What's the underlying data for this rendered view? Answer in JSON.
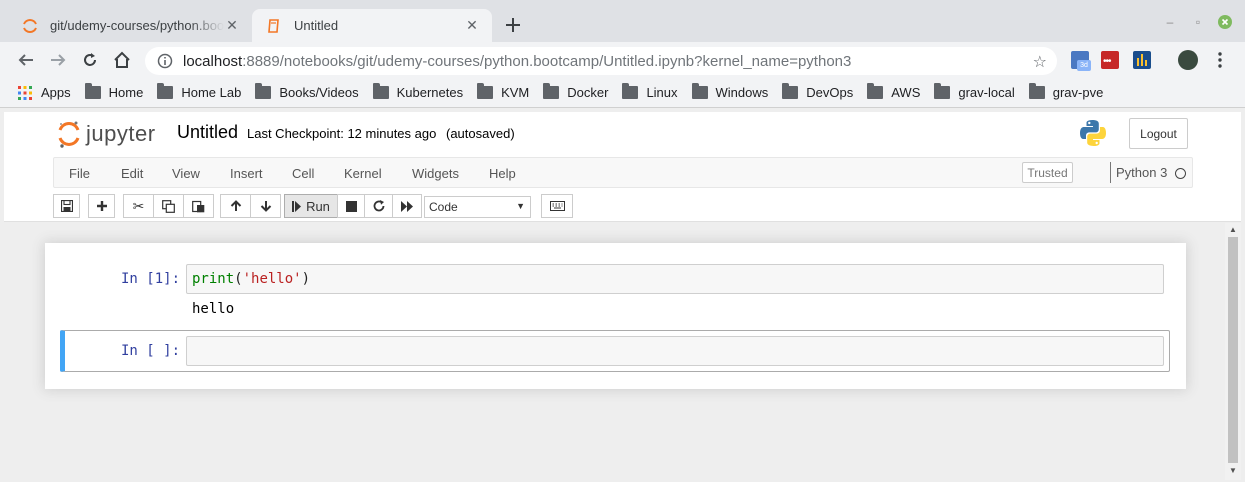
{
  "browser": {
    "tabs": [
      {
        "title": "git/udemy-courses/python.bootcamp/",
        "active": false
      },
      {
        "title": "Untitled",
        "active": true
      }
    ],
    "new_tab_icon": "plus-icon",
    "address": {
      "host": "localhost",
      "rest": ":8889/notebooks/git/udemy-courses/python.bootcamp/Untitled.ipynb?kernel_name=python3"
    },
    "extension_badge": "3d",
    "bookmarks": [
      "Apps",
      "Home",
      "Home Lab",
      "Books/Videos",
      "Kubernetes",
      "KVM",
      "Docker",
      "Linux",
      "Windows",
      "DevOps",
      "AWS",
      "grav-local",
      "grav-pve"
    ]
  },
  "jupyter": {
    "logo_text": "jupyter",
    "notebook_name": "Untitled",
    "checkpoint": "Last Checkpoint: 12 minutes ago",
    "autosave": "(autosaved)",
    "logout_label": "Logout",
    "menu": [
      "File",
      "Edit",
      "View",
      "Insert",
      "Cell",
      "Kernel",
      "Widgets",
      "Help"
    ],
    "trusted_label": "Trusted",
    "kernel_name": "Python 3",
    "run_label": "Run",
    "cell_type": "Code",
    "colors": {
      "prompt": "#303f9f",
      "selected_cell": "#42a5f5",
      "builtin": "#008000",
      "string": "#ba2121"
    }
  },
  "cells": [
    {
      "prompt": "In [1]:",
      "code_builtin": "print",
      "code_open": "(",
      "code_string": "'hello'",
      "code_close": ")",
      "output": "hello"
    },
    {
      "prompt": "In [ ]:",
      "code": ""
    }
  ]
}
